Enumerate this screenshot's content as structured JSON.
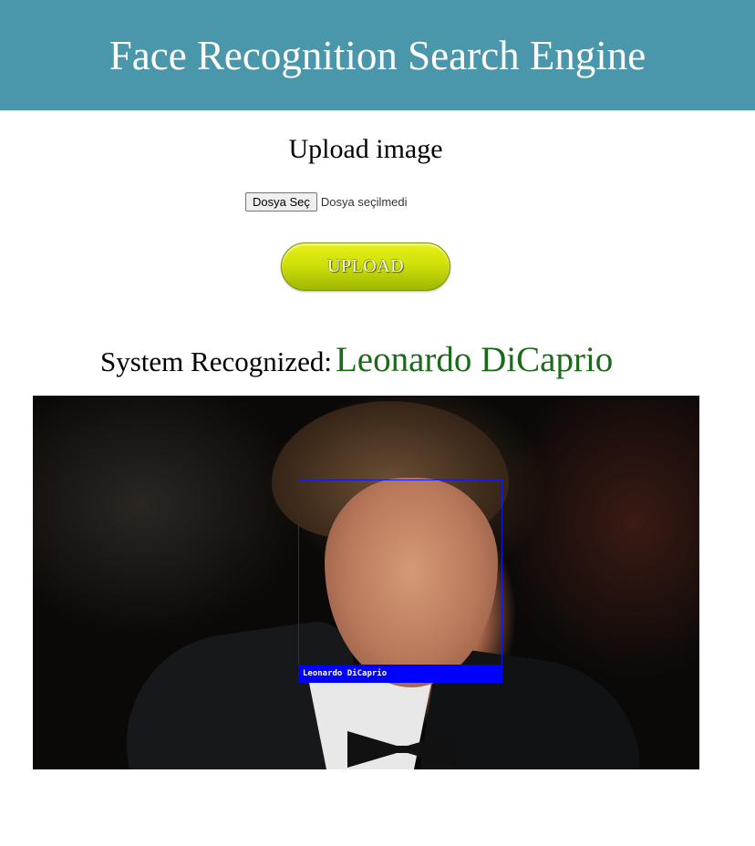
{
  "header": {
    "title": "Face Recognition Search Engine"
  },
  "upload": {
    "heading": "Upload image",
    "file_button_label": "Dosya Seç",
    "file_status": "Dosya seçilmedi",
    "submit_label": "UPLOAD"
  },
  "result": {
    "prefix": "System Recognized:",
    "name": "Leonardo DiCaprio",
    "face_box_label": "Leonardo DiCaprio"
  },
  "colors": {
    "header_bg": "#4a97ab",
    "result_name": "#1a6a1a",
    "upload_button": "#cfe00a",
    "face_box": "#0000ff"
  }
}
